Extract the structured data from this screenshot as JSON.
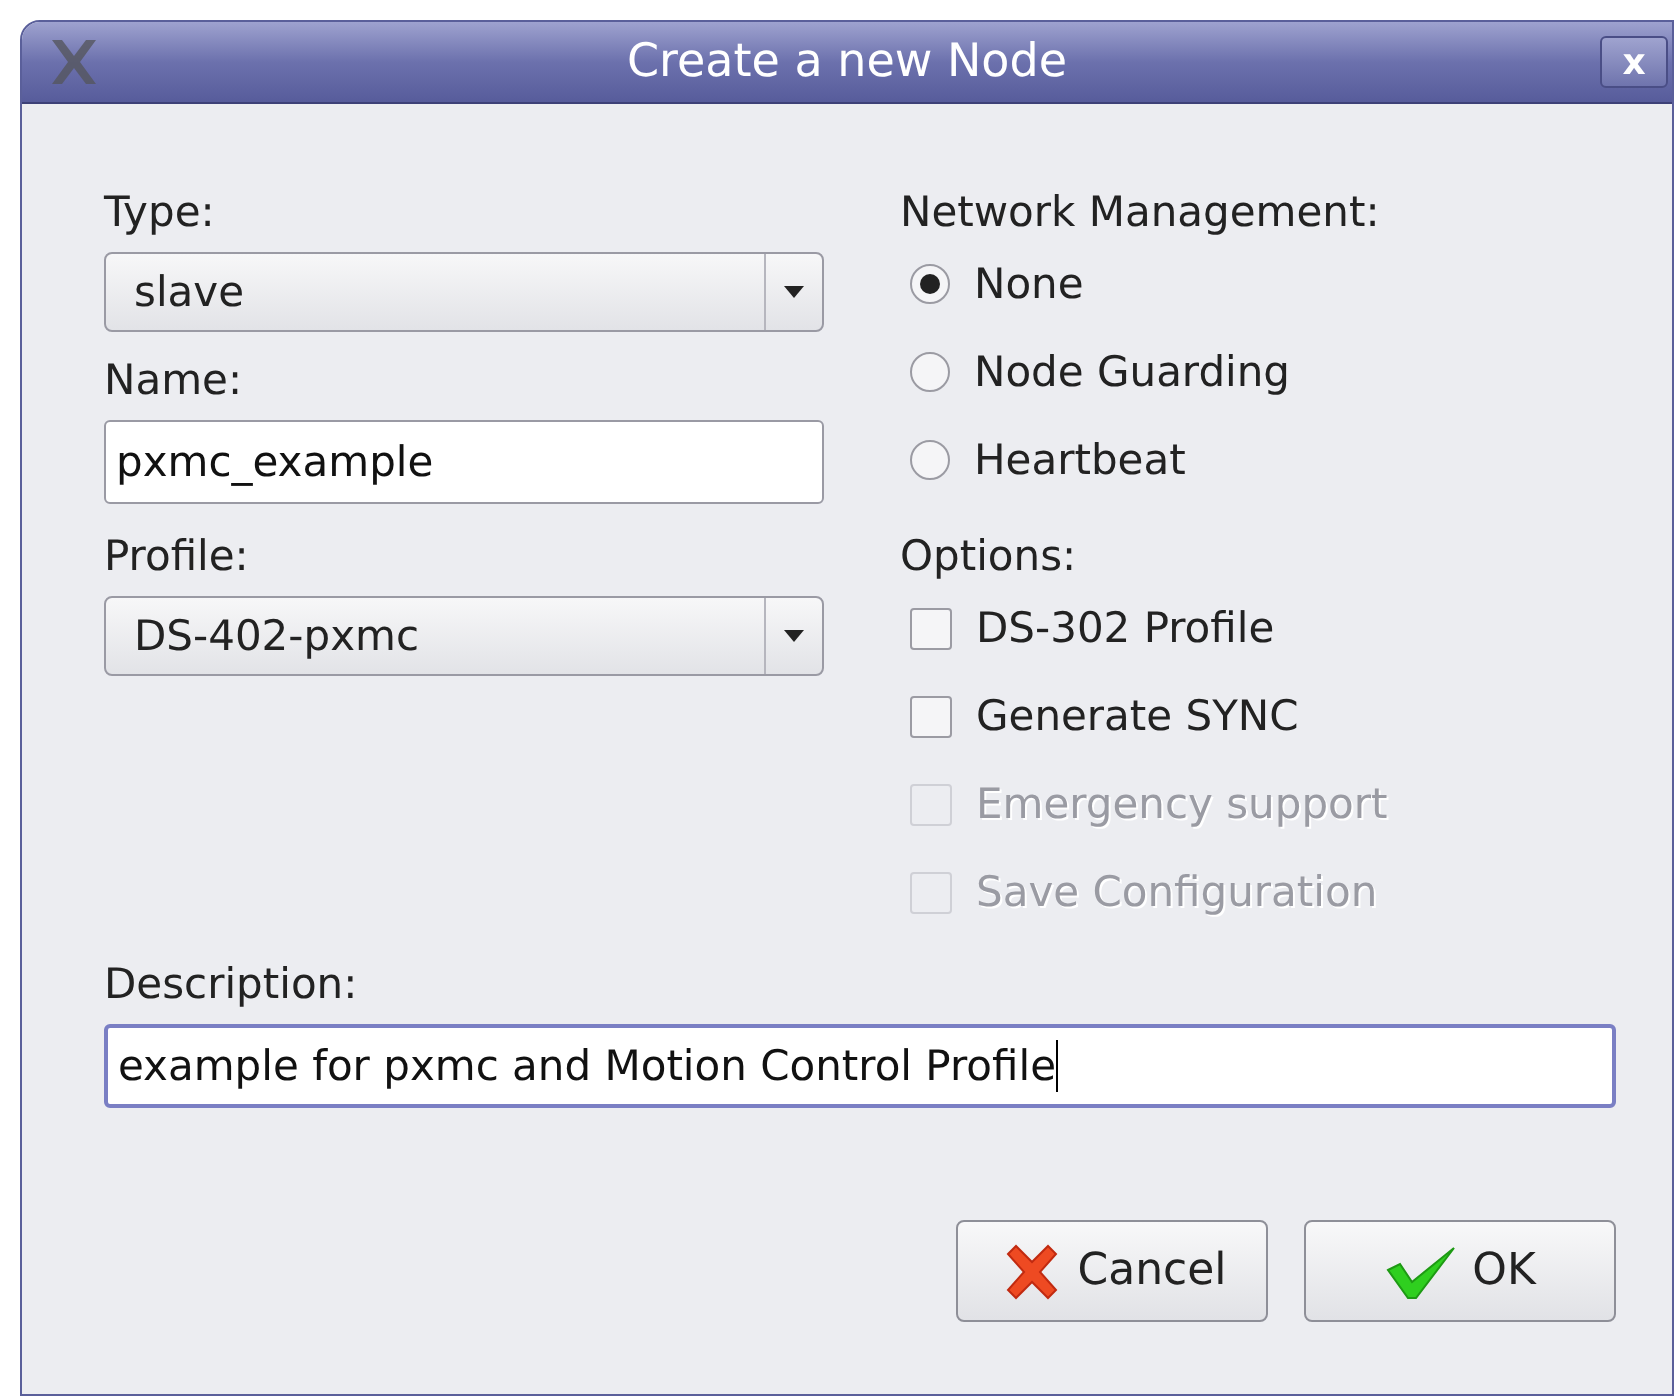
{
  "window": {
    "title": "Create a new Node",
    "close": "x"
  },
  "type": {
    "label": "Type:",
    "value": "slave"
  },
  "name": {
    "label": "Name:",
    "value": "pxmc_example"
  },
  "profile": {
    "label": "Profile:",
    "value": "DS-402-pxmc"
  },
  "network_management": {
    "label": "Network Management:",
    "options": [
      {
        "label": "None",
        "selected": true
      },
      {
        "label": "Node Guarding",
        "selected": false
      },
      {
        "label": "Heartbeat",
        "selected": false
      }
    ]
  },
  "options": {
    "label": "Options:",
    "items": [
      {
        "label": "DS-302 Profile",
        "checked": false,
        "disabled": false
      },
      {
        "label": "Generate SYNC",
        "checked": false,
        "disabled": false
      },
      {
        "label": "Emergency support",
        "checked": false,
        "disabled": true
      },
      {
        "label": "Save Configuration",
        "checked": false,
        "disabled": true
      }
    ]
  },
  "description": {
    "label": "Description:",
    "value": "example for pxmc and Motion Control Profile",
    "focused": true
  },
  "buttons": [
    {
      "kind": "cancel",
      "label": "Cancel"
    },
    {
      "kind": "ok",
      "label": "OK"
    }
  ]
}
